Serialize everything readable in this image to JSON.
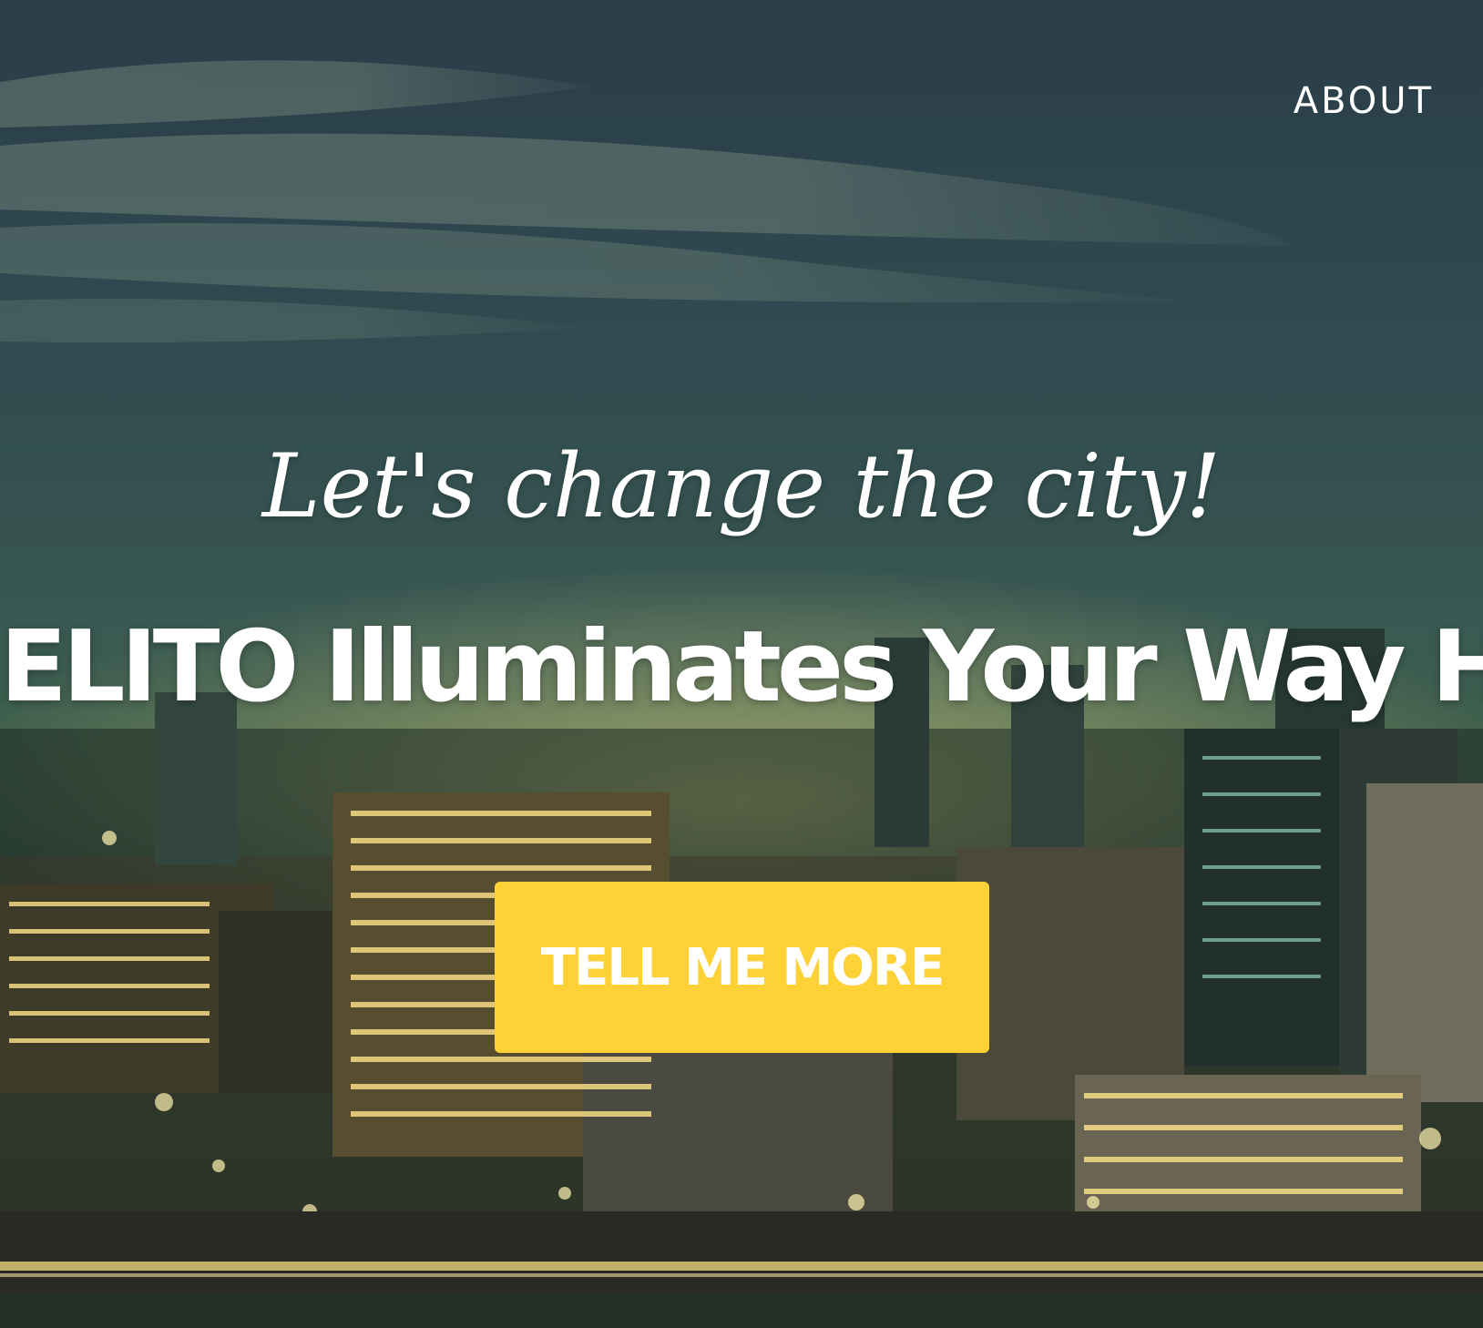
{
  "nav": {
    "about_label": "ABOUT"
  },
  "hero": {
    "tagline": "Let's change the city!",
    "headline": "ELITO Illuminates Your Way Home",
    "cta_label": "TELL ME MORE"
  },
  "colors": {
    "accent": "#fed136",
    "text": "#ffffff",
    "sky": "#2f4a50"
  }
}
